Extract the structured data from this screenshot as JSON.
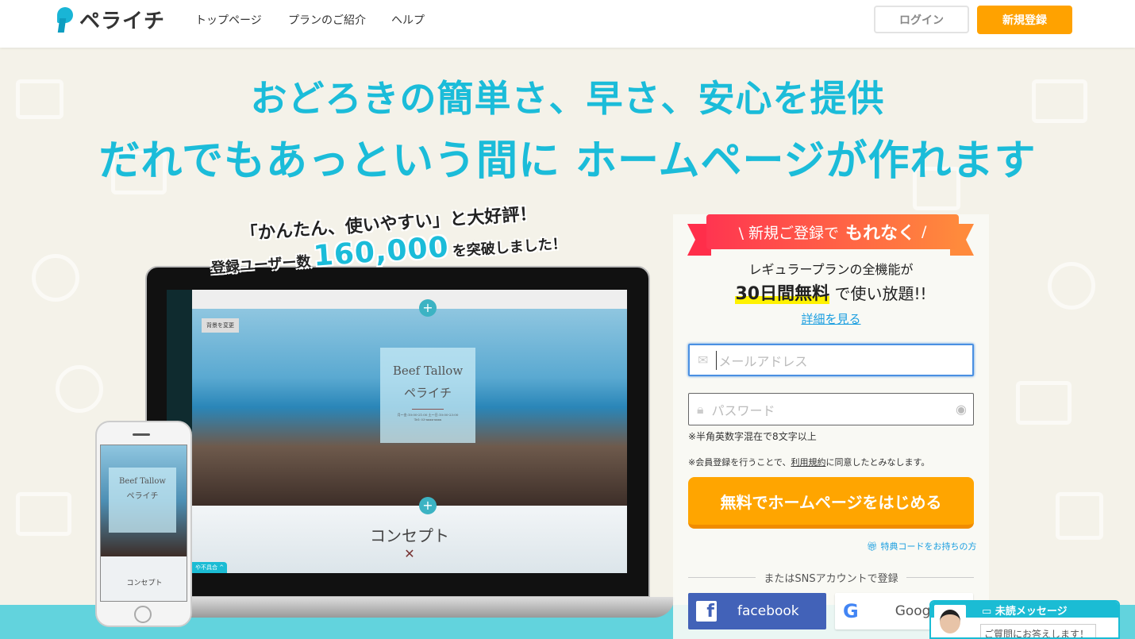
{
  "header": {
    "logo_text": "ペライチ",
    "nav": [
      "トップページ",
      "プランのご紹介",
      "ヘルプ"
    ],
    "login_label": "ログイン",
    "signup_label": "新規登録"
  },
  "hero": {
    "headline_1": "おどろきの簡単さ、早さ、安心を提供",
    "headline_2": "だれでもあっという間に ホームページが作れます",
    "accent_color": "#1bbcd9"
  },
  "tagline": {
    "line_1": "「かんたん、使いやすい」と大好評！",
    "prefix": "登録ユーザー数",
    "count": "160,000",
    "suffix": "を突破しました！"
  },
  "mockup": {
    "bg_change": "背景を変更",
    "title_en": "Beef Tallow",
    "title_ja": "ペライチ",
    "hours": "月〜金:10:00-21:00 土〜日:10:00-23:00",
    "tel": "Tel: 03-xxxx-xxxx",
    "concept": "コンセプト",
    "help_tab": "や不具合 ^"
  },
  "signup": {
    "ribbon_pre": "\\ 新規ご登録で",
    "ribbon_bold": "もれなく",
    "ribbon_post": "/",
    "line_1": "レギュラープランの全機能が",
    "highlight": "30日間無料",
    "line_2_rest": "で使い放題!!",
    "details_link": "詳細を見る",
    "email_placeholder": "メールアドレス",
    "password_placeholder": "パスワード",
    "password_hint": "※半角英数字混在で8文字以上",
    "terms_pre": "※会員登録を行うことで、",
    "terms_link": "利用規約",
    "terms_post": "に同意したとみなします。",
    "cta": "無料でホームページをはじめる",
    "promo_link": "特典コードをお持ちの方",
    "sns_divider": "またはSNSアカウントで登録",
    "facebook": "facebook",
    "google": "Google"
  },
  "chat": {
    "title": "未読メッセージ",
    "message": "ご質問にお答えします！"
  },
  "colors": {
    "orange": "#ffa500",
    "facebook": "#4262b8",
    "chat": "#1bbcd4"
  }
}
